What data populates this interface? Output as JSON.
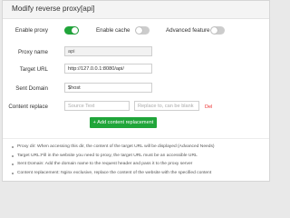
{
  "dialog": {
    "title": "Modify reverse proxy[api]"
  },
  "form": {
    "enable_proxy": {
      "label": "Enable proxy",
      "on": true
    },
    "enable_cache": {
      "label": "Enable cache",
      "on": false
    },
    "advanced_feature": {
      "label": "Advanced feature",
      "on": false
    },
    "proxy_name": {
      "label": "Proxy name",
      "value": "api"
    },
    "target_url": {
      "label": "Target URL",
      "value": "http://127.0.0.1:8080/api/"
    },
    "sent_domain": {
      "label": "Sent Domain",
      "value": "$host"
    },
    "content_replace": {
      "label": "Content replace",
      "source_placeholder": "Source Text",
      "replace_placeholder": "Replace to, can be blank",
      "delete_label": "Del"
    },
    "add_button": "+ Add content replacement"
  },
  "notes": [
    "Proxy dir: When accessing this dir, the content of the target URL will be displayed (Advanced Needs)",
    "Target URL:Fill in the website you need to proxy, the target URL must be an accessible URL",
    "Sent Domain: Add the domain name to the request header and pass it to the proxy server",
    "Content replacement: Nginx exclusive, replace the content of the website with the specified content"
  ],
  "colors": {
    "accent": "#20a53a",
    "danger": "#ee3333",
    "toggle_off": "#cccccc"
  }
}
